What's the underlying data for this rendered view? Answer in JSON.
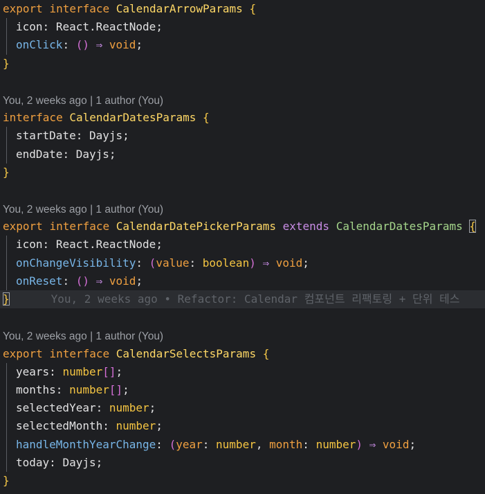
{
  "blocks": [
    {
      "blame": "",
      "keywords": "export interface",
      "name": "CalendarArrowParams",
      "open": "{",
      "members": [
        {
          "key": "icon",
          "value": "React.ReactNode"
        },
        {
          "key": "onClick",
          "params": "()",
          "ret": "void"
        }
      ]
    },
    {
      "blame": "You, 2 weeks ago | 1 author (You)",
      "keywords": "interface",
      "name": "CalendarDatesParams",
      "members": [
        {
          "key": "startDate",
          "value": "Dayjs"
        },
        {
          "key": "endDate",
          "value": "Dayjs"
        }
      ]
    },
    {
      "blame": "You, 2 weeks ago | 1 author (You)",
      "keywords": "export interface",
      "name": "CalendarDatePickerParams",
      "extends_kw": "extends",
      "extends_name": "CalendarDatesParams",
      "members": [
        {
          "key": "icon",
          "value": "React.ReactNode"
        },
        {
          "key": "onChangeVisibility",
          "param_name": "value",
          "param_type": "boolean",
          "ret": "void"
        },
        {
          "key": "onReset",
          "params": "()",
          "ret": "void"
        }
      ],
      "inline_blame": "You, 2 weeks ago • Refactor: Calendar 컴포넌트 리팩토링 + 단위 테스"
    },
    {
      "blame": "You, 2 weeks ago | 1 author (You)",
      "keywords": "export interface",
      "name": "CalendarSelectsParams",
      "members": [
        {
          "key": "years",
          "value": "number[]"
        },
        {
          "key": "months",
          "value": "number[]"
        },
        {
          "key": "selectedYear",
          "value": "number"
        },
        {
          "key": "selectedMonth",
          "value": "number"
        },
        {
          "key": "handleMonthYearChange",
          "p1": "year",
          "p2": "month",
          "ptype": "number",
          "ret": "void"
        },
        {
          "key": "today",
          "value": "Dayjs"
        }
      ]
    }
  ],
  "tokens": {
    "export": "export",
    "interface": "interface",
    "void": "void",
    "arrow": "⇒",
    "open_brace": "{",
    "close_brace": "}",
    "colon": ":",
    "semi": ";",
    "comma": ",",
    "lparen": "(",
    "rparen": ")",
    "empty_parens": "()",
    "react": "React",
    "reactnode": "ReactNode",
    "dot": ".",
    "dayjs": "Dayjs",
    "number": "number",
    "brackets": "[]",
    "boolean": "boolean"
  },
  "colors": {
    "background": "#1e1f22",
    "keyword": "#f0a040",
    "interface_name": "#ffd866",
    "function_prop": "#78b6e8",
    "brace": "#f7c948",
    "paren": "#d46fd6",
    "blame_text": "#9da0a6"
  }
}
